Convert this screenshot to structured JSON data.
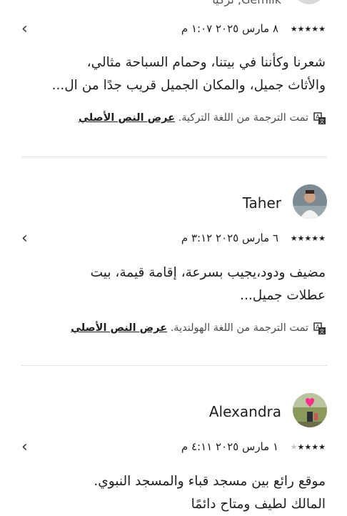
{
  "reviews": [
    {
      "reviewer_location": "Gemlik, تركيا",
      "rating": 5,
      "stars_display": "★★★★★",
      "date": "٨ مارس ٢٠٢٥ ١:٠٧ م",
      "body_line1": "شعرنا وكأننا في بيتنا، وحمام السباحة مثالي،",
      "body_line2": "والأثاث جميل، والمكان الجميل قريب جدًا من ال...",
      "translation_note": "تمت الترجمة من اللغة التركية.",
      "show_original": "عرض النص الأصلي"
    },
    {
      "reviewer_name": "Taher",
      "rating": 5,
      "stars_display": "★★★★★",
      "date": "٦ مارس ٢٠٢٥ ٣:١٢ م",
      "body_line1": "مضيف ودود،يجيب بسرعة، إقامة قيمة، بيت",
      "body_line2": "عطلات جميل...",
      "translation_note": "تمت الترجمة من اللغة الهولندية.",
      "show_original": "عرض النص الأصلي"
    },
    {
      "reviewer_name": "Alexandra",
      "rating": 4,
      "stars_display": "★★★★",
      "stars_off": "★",
      "date": "١ مارس ٢٠٢٥ ٤:١١ م",
      "body_line1": "موقع رائع بين مسجد قباء والمسجد النبوي.",
      "body_line2": "المالك لطيف ومتاح دائمًا"
    }
  ],
  "icons": {
    "chevron": "‹",
    "translate": "translate-icon"
  },
  "colors": {
    "text": "#1f1f1f",
    "muted": "#4d4d4d",
    "divider": "#e3e3e3"
  }
}
